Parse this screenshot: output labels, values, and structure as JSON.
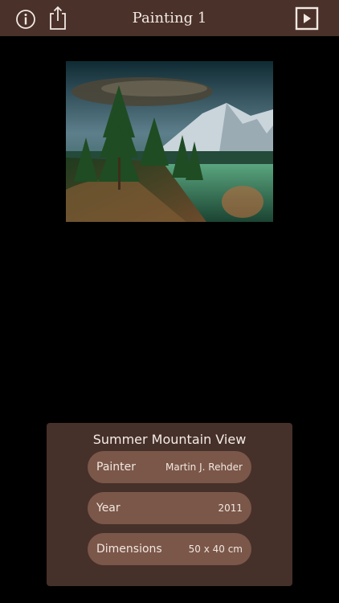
{
  "header": {
    "title": "Painting 1",
    "info_icon": "info-icon",
    "share_icon": "share-icon",
    "play_icon": "play-icon"
  },
  "colors": {
    "toolbar": "#4a3129",
    "panel": "#46302a",
    "pill": "#7a5749",
    "text": "#f3e7e0"
  },
  "details": {
    "title": "Summer Mountain View",
    "rows": [
      {
        "label": "Painter",
        "value": "Martin J. Rehder"
      },
      {
        "label": "Year",
        "value": "2011"
      },
      {
        "label": "Dimensions",
        "value": "50 x 40 cm"
      }
    ]
  }
}
